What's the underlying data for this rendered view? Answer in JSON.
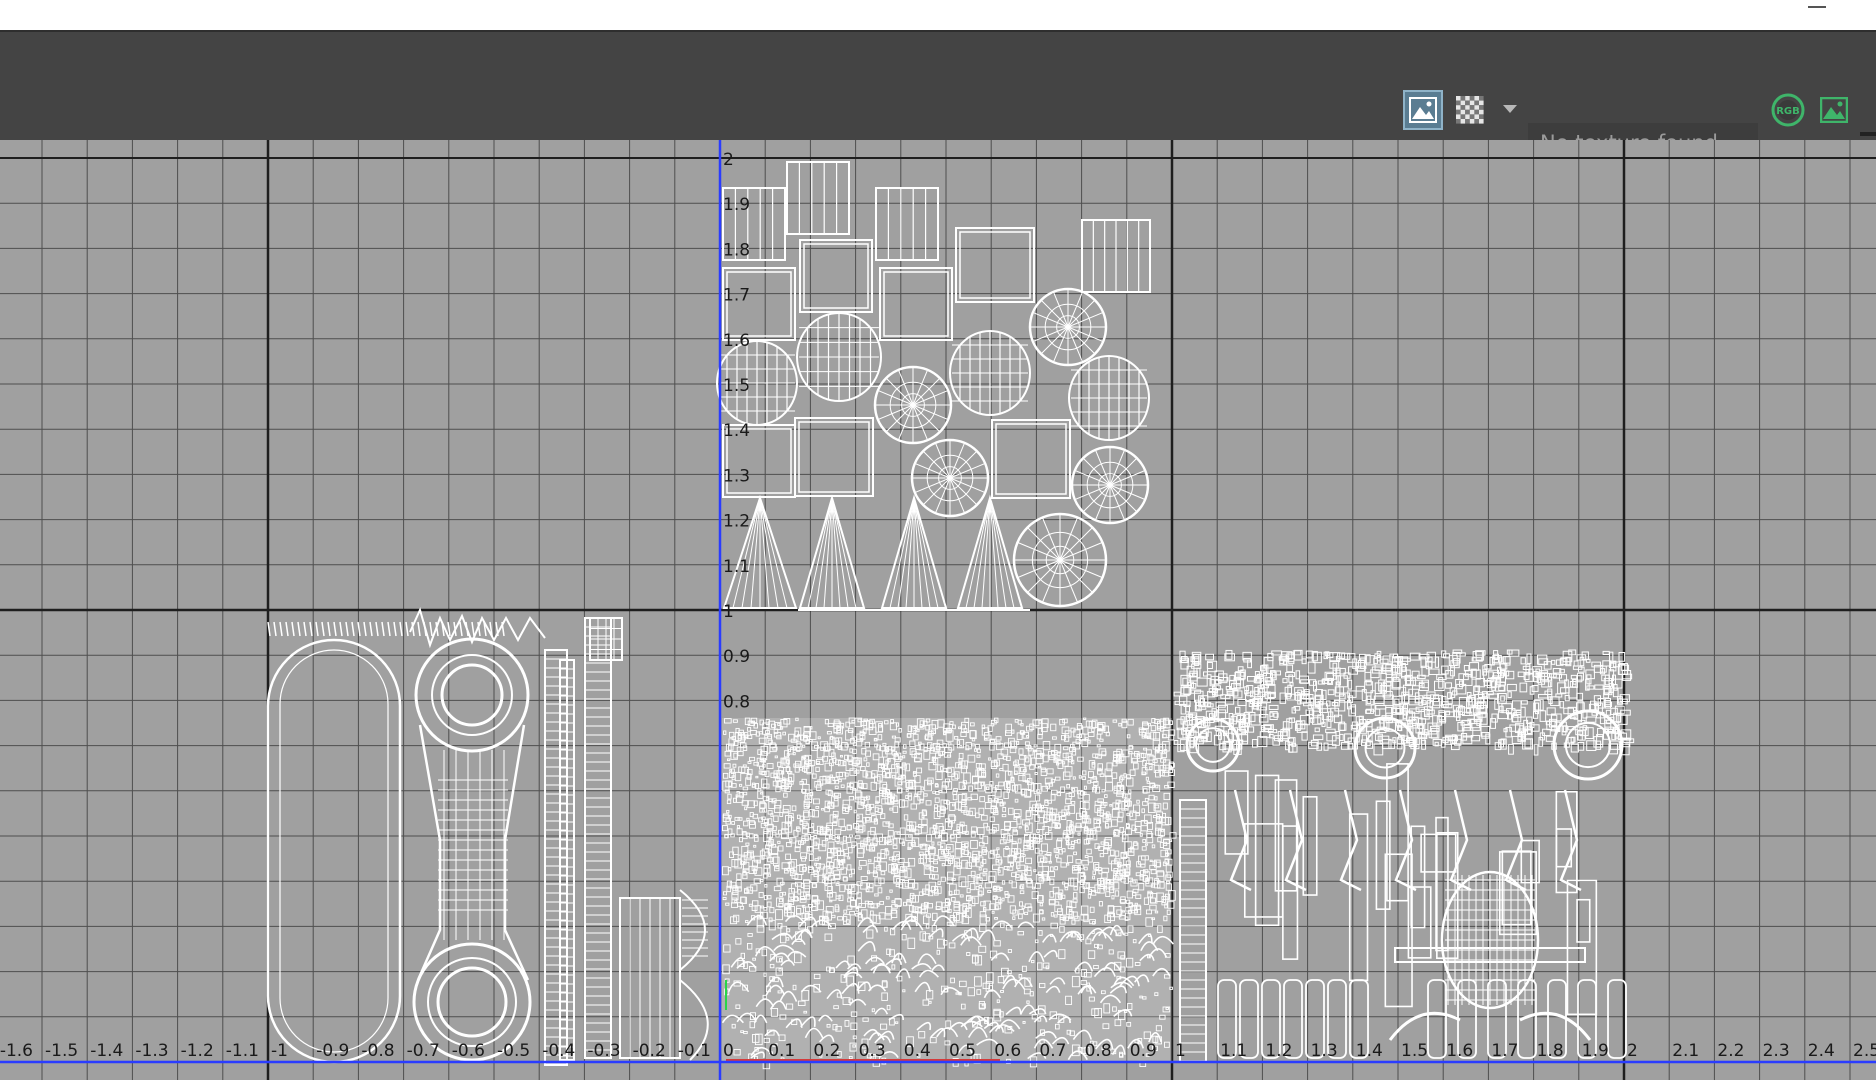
{
  "toolbar": {
    "texture_status": "No texture found",
    "buttons": [
      {
        "name": "image-display-toggle",
        "icon": "image-icon",
        "active": true
      },
      {
        "name": "checker-toggle",
        "icon": "checker-icon",
        "active": false
      },
      {
        "name": "checker-options",
        "icon": "chevron-down-icon",
        "active": false
      },
      {
        "name": "rgb-channel-toggle",
        "icon": "rgb-icon",
        "active": false
      },
      {
        "name": "image-display-toggle-2",
        "icon": "image-icon",
        "active": false
      }
    ],
    "rgb_label": "RGB"
  },
  "uv_editor": {
    "u_axis_labels": [
      "-1.6",
      "-1.5",
      "-1.4",
      "-1.3",
      "-1.2",
      "-1.1",
      "-1",
      "-0.9",
      "-0.8",
      "-0.7",
      "-0.6",
      "-0.5",
      "-0.4",
      "-0.3",
      "-0.2",
      "-0.1",
      "0",
      "0.1",
      "0.2",
      "0.3",
      "0.4",
      "0.5",
      "0.6",
      "0.7",
      "0.8",
      "0.9",
      "1",
      "1.1",
      "1.2",
      "1.3",
      "1.4",
      "1.5",
      "1.6",
      "1.7",
      "1.8",
      "1.9",
      "2",
      "2.1",
      "2.2",
      "2.3",
      "2.4",
      "2.5"
    ],
    "v_axis_labels": [
      "2",
      "1.9",
      "1.8",
      "1.7",
      "1.6",
      "1.5",
      "1.4",
      "1.3",
      "1.2",
      "1.1",
      "1",
      "0.9",
      "0.8"
    ],
    "colors": {
      "grid_bg": "#a0a0a0",
      "grid_minor": "#4e4e4e",
      "grid_major": "#1e1e1e",
      "v_axis": "#2a3cff",
      "u_axis": "#2a3cff",
      "wireframe": "#ffffff"
    }
  }
}
